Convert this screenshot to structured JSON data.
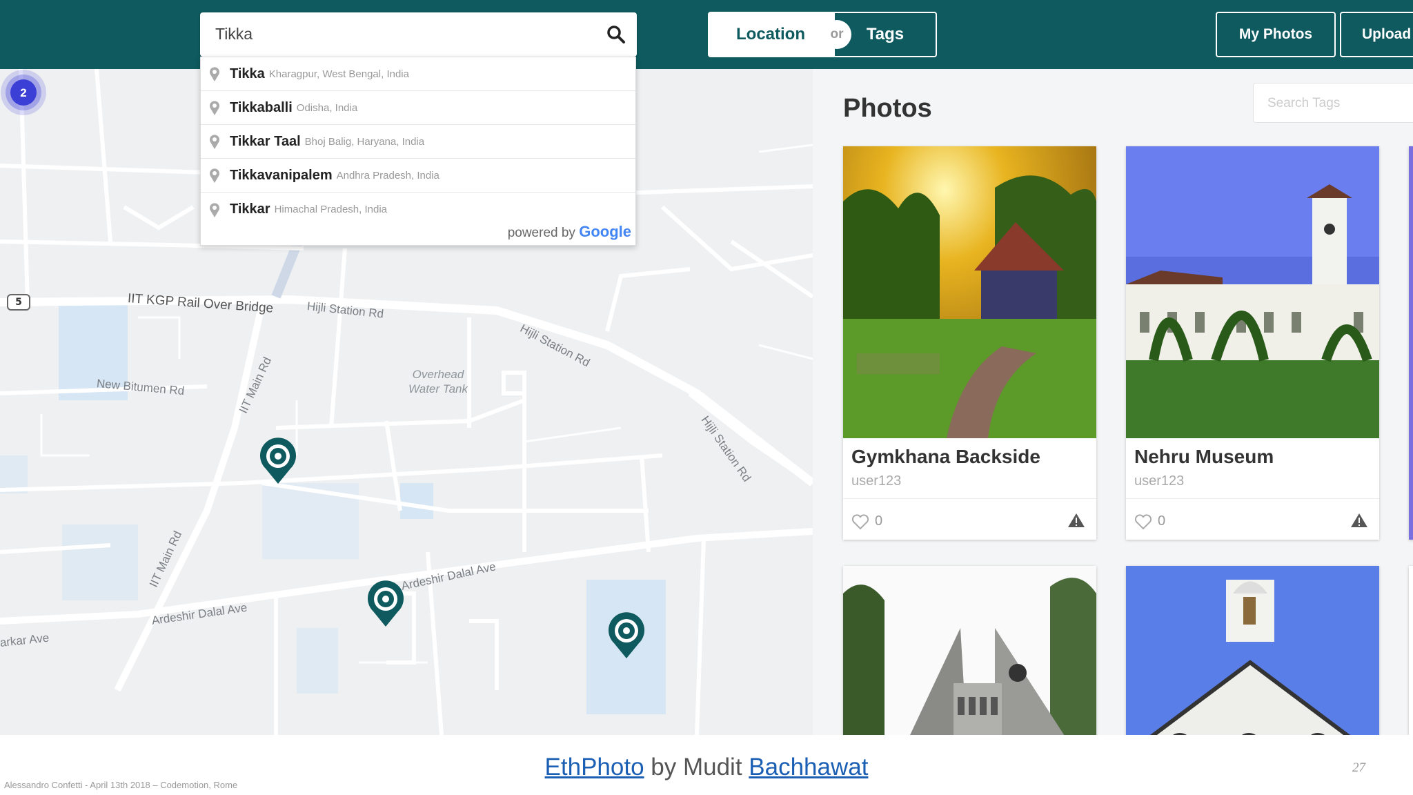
{
  "header": {
    "search_value": "Tikka",
    "toggle": {
      "location": "Location",
      "or": "or",
      "tags": "Tags"
    },
    "buttons": {
      "my_photos": "My Photos",
      "upload": "Upload"
    }
  },
  "autocomplete": {
    "suggestions": [
      {
        "main": "Tikka",
        "secondary": "Kharagpur, West Bengal, India"
      },
      {
        "main": "Tikkaballi",
        "secondary": "Odisha, India"
      },
      {
        "main": "Tikkar Taal",
        "secondary": "Bhoj Balig, Haryana, India"
      },
      {
        "main": "Tikkavanipalem",
        "secondary": "Andhra Pradesh, India"
      },
      {
        "main": "Tikkar",
        "secondary": "Himachal Pradesh, India"
      }
    ],
    "powered_by": "powered by",
    "google": "Google"
  },
  "map": {
    "route_number": "5",
    "road_labels": {
      "rail_bridge": "IIT KGP Rail Over Bridge",
      "hijli_1": "Hijli Station Rd",
      "hijli_2": "Hijli Station Rd",
      "hijli_3": "Hijli Station Rd",
      "iit_main_1": "IIT Main Rd",
      "iit_main_2": "IIT Main Rd",
      "new_bitumen": "New Bitumen Rd",
      "ardeshir_1": "Ardeshir Dalal Ave",
      "ardeshir_2": "Ardeshir Dalal Ave",
      "arkar": "arkar Ave"
    },
    "poi": {
      "line1": "Overhead",
      "line2": "Water Tank"
    },
    "cluster_count": "2"
  },
  "panel": {
    "title": "Photos",
    "tag_search_placeholder": "Search Tags",
    "cards": [
      {
        "title": "Gymkhana Backside",
        "user": "user123",
        "likes": "0"
      },
      {
        "title": "Nehru Museum",
        "user": "user123",
        "likes": "0"
      }
    ]
  },
  "footer": {
    "app_link": "EthPhoto",
    "by_text": " by Mudit ",
    "author_link": "Bachhawat",
    "credit": "Alessandro Confetti - April 13th 2018 – Codemotion, Rome",
    "page_number": "27"
  },
  "colors": {
    "header": "#0e5a5e",
    "marker": "#0e5a5e",
    "cluster": "#3b3fd6",
    "link": "#1a5fb4"
  }
}
